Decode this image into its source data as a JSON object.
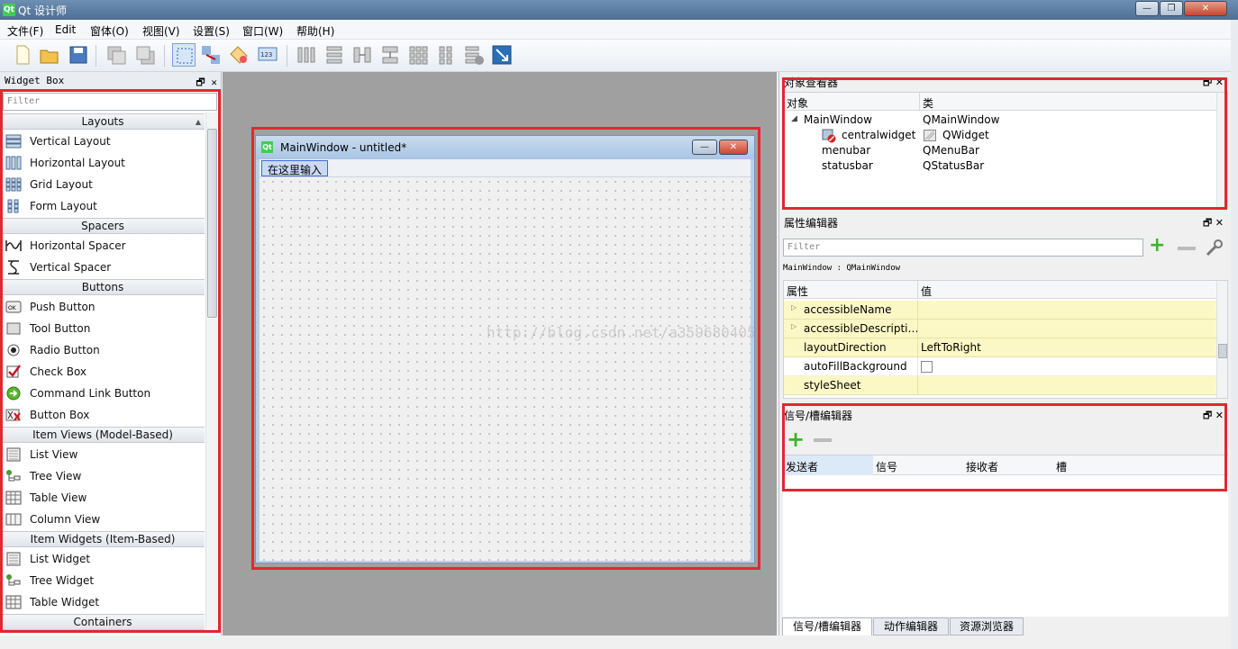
{
  "window": {
    "title": "Qt 设计师"
  },
  "menus": [
    "文件(F)",
    "Edit",
    "窗体(O)",
    "视图(V)",
    "设置(S)",
    "窗口(W)",
    "帮助(H)"
  ],
  "widget_box": {
    "title": "Widget Box",
    "filter_placeholder": "Filter",
    "categories": {
      "layouts": "Layouts",
      "spacers": "Spacers",
      "buttons": "Buttons",
      "item_views": "Item Views (Model-Based)",
      "item_widgets": "Item Widgets (Item-Based)",
      "containers": "Containers"
    },
    "items": {
      "vertical_layout": "Vertical Layout",
      "horizontal_layout": "Horizontal Layout",
      "grid_layout": "Grid Layout",
      "form_layout": "Form Layout",
      "horizontal_spacer": "Horizontal Spacer",
      "vertical_spacer": "Vertical Spacer",
      "push_button": "Push Button",
      "tool_button": "Tool Button",
      "radio_button": "Radio Button",
      "check_box": "Check Box",
      "command_link_button": "Command Link Button",
      "button_box": "Button Box",
      "list_view": "List View",
      "tree_view": "Tree View",
      "table_view": "Table View",
      "column_view": "Column View",
      "list_widget": "List Widget",
      "tree_widget": "Tree Widget",
      "table_widget": "Table Widget"
    }
  },
  "form": {
    "title": "MainWindow - untitled*",
    "menu_placeholder": "在这里输入"
  },
  "object_inspector": {
    "title": "对象查看器",
    "col_object": "对象",
    "col_class": "类",
    "rows": [
      {
        "object": "MainWindow",
        "class": "QMainWindow"
      },
      {
        "object": "centralwidget",
        "class": "QWidget"
      },
      {
        "object": "menubar",
        "class": "QMenuBar"
      },
      {
        "object": "statusbar",
        "class": "QStatusBar"
      }
    ]
  },
  "property_editor": {
    "title": "属性编辑器",
    "filter_placeholder": "Filter",
    "context": "MainWindow : QMainWindow",
    "col_property": "属性",
    "col_value": "值",
    "rows": [
      {
        "name": "accessibleName",
        "value": ""
      },
      {
        "name": "accessibleDescripti…",
        "value": ""
      },
      {
        "name": "layoutDirection",
        "value": "LeftToRight"
      },
      {
        "name": "autoFillBackground",
        "value": ""
      },
      {
        "name": "styleSheet",
        "value": ""
      }
    ]
  },
  "signal_slot_editor": {
    "title": "信号/槽编辑器",
    "col_sender": "发送者",
    "col_signal": "信号",
    "col_receiver": "接收者",
    "col_slot": "槽"
  },
  "bottom_tabs": [
    "信号/槽编辑器",
    "动作编辑器",
    "资源浏览器"
  ],
  "watermark": "http://blog.csdn.net/a359680405",
  "colors": {
    "highlight_red": "#e2272f",
    "property_row_yellow": "#fcf8c5",
    "central_gray": "#a0a0a0"
  }
}
